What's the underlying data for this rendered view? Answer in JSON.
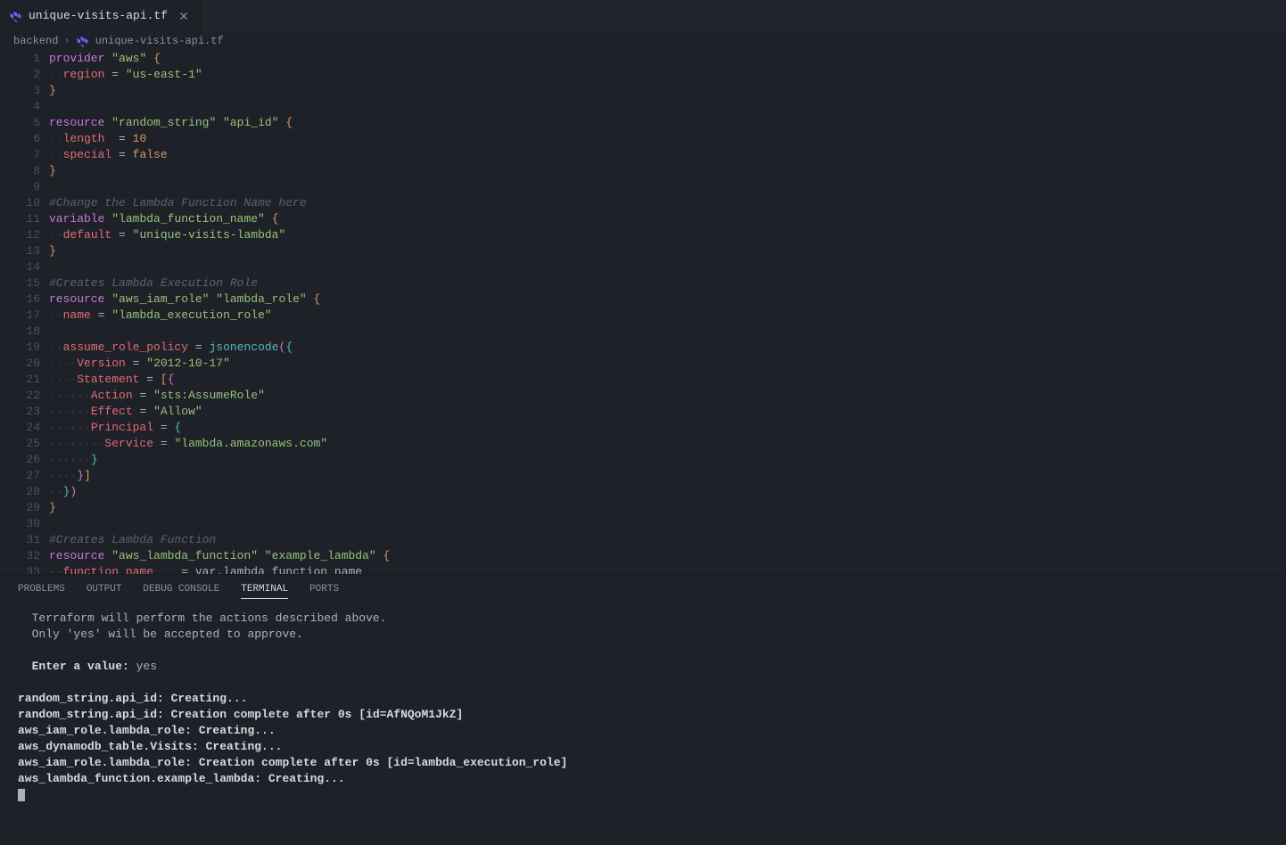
{
  "tab": {
    "filename": "unique-visits-api.tf"
  },
  "breadcrumb": {
    "folder": "backend",
    "file": "unique-visits-api.tf"
  },
  "code_lines": [
    {
      "n": 1,
      "html": "<span class='kw'>provider</span> <span class='str'>\"aws\"</span> <span class='brace-y'>{</span>"
    },
    {
      "n": 2,
      "html": "<span class='dots'>··</span><span class='attr'>region</span> <span class='punct'>=</span> <span class='str'>\"us-east-1\"</span>"
    },
    {
      "n": 3,
      "html": "<span class='brace-y'>}</span>"
    },
    {
      "n": 4,
      "html": ""
    },
    {
      "n": 5,
      "html": "<span class='kw'>resource</span> <span class='str'>\"random_string\"</span> <span class='str'>\"api_id\"</span> <span class='brace-y'>{</span>"
    },
    {
      "n": 6,
      "html": "<span class='dots'>··</span><span class='attr'>length</span>  <span class='punct'>=</span> <span class='num'>10</span>"
    },
    {
      "n": 7,
      "html": "<span class='dots'>··</span><span class='attr'>special</span> <span class='punct'>=</span> <span class='bool'>false</span>"
    },
    {
      "n": 8,
      "html": "<span class='brace-y'>}</span>"
    },
    {
      "n": 9,
      "html": ""
    },
    {
      "n": 10,
      "html": "<span class='comment'>#Change the Lambda Function Name here</span>"
    },
    {
      "n": 11,
      "html": "<span class='kw'>variable</span> <span class='str'>\"lambda_function_name\"</span> <span class='brace-y'>{</span>"
    },
    {
      "n": 12,
      "html": "<span class='dots'>··</span><span class='attr'>default</span> <span class='punct'>=</span> <span class='str'>\"unique-visits-lambda\"</span>"
    },
    {
      "n": 13,
      "html": "<span class='brace-y'>}</span>"
    },
    {
      "n": 14,
      "html": ""
    },
    {
      "n": 15,
      "html": "<span class='comment'>#Creates Lambda Execution Role</span>"
    },
    {
      "n": 16,
      "html": "<span class='kw'>resource</span> <span class='str'>\"aws_iam_role\"</span> <span class='str'>\"lambda_role\"</span> <span class='brace-y'>{</span>"
    },
    {
      "n": 17,
      "html": "<span class='dots'>··</span><span class='attr'>name</span> <span class='punct'>=</span> <span class='str'>\"lambda_execution_role\"</span>"
    },
    {
      "n": 18,
      "html": ""
    },
    {
      "n": 19,
      "html": "<span class='dots'>··</span><span class='attr'>assume_role_policy</span> <span class='punct'>=</span> <span class='func'>jsonencode</span><span class='brace-p'>(</span><span class='brace-b'>{</span>"
    },
    {
      "n": 20,
      "html": "<span class='dots'>····</span><span class='attr'>Version</span> <span class='punct'>=</span> <span class='str'>\"2012-10-17\"</span>"
    },
    {
      "n": 21,
      "html": "<span class='dots'>····</span><span class='attr'>Statement</span> <span class='punct'>=</span> <span class='brace-y'>[</span><span class='brace-p'>{</span>"
    },
    {
      "n": 22,
      "html": "<span class='dots'>······</span><span class='attr'>Action</span> <span class='punct'>=</span> <span class='str'>\"sts:AssumeRole\"</span>"
    },
    {
      "n": 23,
      "html": "<span class='dots'>······</span><span class='attr'>Effect</span> <span class='punct'>=</span> <span class='str'>\"Allow\"</span>"
    },
    {
      "n": 24,
      "html": "<span class='dots'>······</span><span class='attr'>Principal</span> <span class='punct'>=</span> <span class='brace-b'>{</span>"
    },
    {
      "n": 25,
      "html": "<span class='dots'>········</span><span class='attr'>Service</span> <span class='punct'>=</span> <span class='str'>\"lambda.amazonaws.com\"</span>"
    },
    {
      "n": 26,
      "html": "<span class='dots'>······</span><span class='brace-b'>}</span>"
    },
    {
      "n": 27,
      "html": "<span class='dots'>····</span><span class='brace-p'>}</span><span class='brace-y'>]</span>"
    },
    {
      "n": 28,
      "html": "<span class='dots'>··</span><span class='brace-b'>}</span><span class='brace-p'>)</span>"
    },
    {
      "n": 29,
      "html": "<span class='brace-y'>}</span>"
    },
    {
      "n": 30,
      "html": ""
    },
    {
      "n": 31,
      "html": "<span class='comment'>#Creates Lambda Function</span>"
    },
    {
      "n": 32,
      "html": "<span class='kw'>resource</span> <span class='str'>\"aws_lambda_function\"</span> <span class='str'>\"example_lambda\"</span> <span class='brace-y'>{</span>"
    },
    {
      "n": 33,
      "html": "<span class='dots'>··</span><span class='attr'>function_name</span>    <span class='punct'>=</span> var.lambda_function_name"
    }
  ],
  "panel": {
    "tabs": [
      "PROBLEMS",
      "OUTPUT",
      "DEBUG CONSOLE",
      "TERMINAL",
      "PORTS"
    ],
    "active_tab": "TERMINAL"
  },
  "terminal_lines": [
    {
      "cls": "term-normal",
      "text": "  Terraform will perform the actions described above."
    },
    {
      "cls": "term-normal",
      "text": "  Only 'yes' will be accepted to approve."
    },
    {
      "cls": "term-normal",
      "text": ""
    },
    {
      "cls": "mixed",
      "prefix": "  ",
      "bold": "Enter a value:",
      "rest": " yes"
    },
    {
      "cls": "term-normal",
      "text": ""
    },
    {
      "cls": "term-bold",
      "text": "random_string.api_id: Creating..."
    },
    {
      "cls": "term-bold",
      "text": "random_string.api_id: Creation complete after 0s [id=AfNQoM1JkZ]"
    },
    {
      "cls": "term-bold",
      "text": "aws_iam_role.lambda_role: Creating..."
    },
    {
      "cls": "term-bold",
      "text": "aws_dynamodb_table.Visits: Creating..."
    },
    {
      "cls": "term-bold",
      "text": "aws_iam_role.lambda_role: Creation complete after 0s [id=lambda_execution_role]"
    },
    {
      "cls": "term-bold",
      "text": "aws_lambda_function.example_lambda: Creating..."
    }
  ]
}
